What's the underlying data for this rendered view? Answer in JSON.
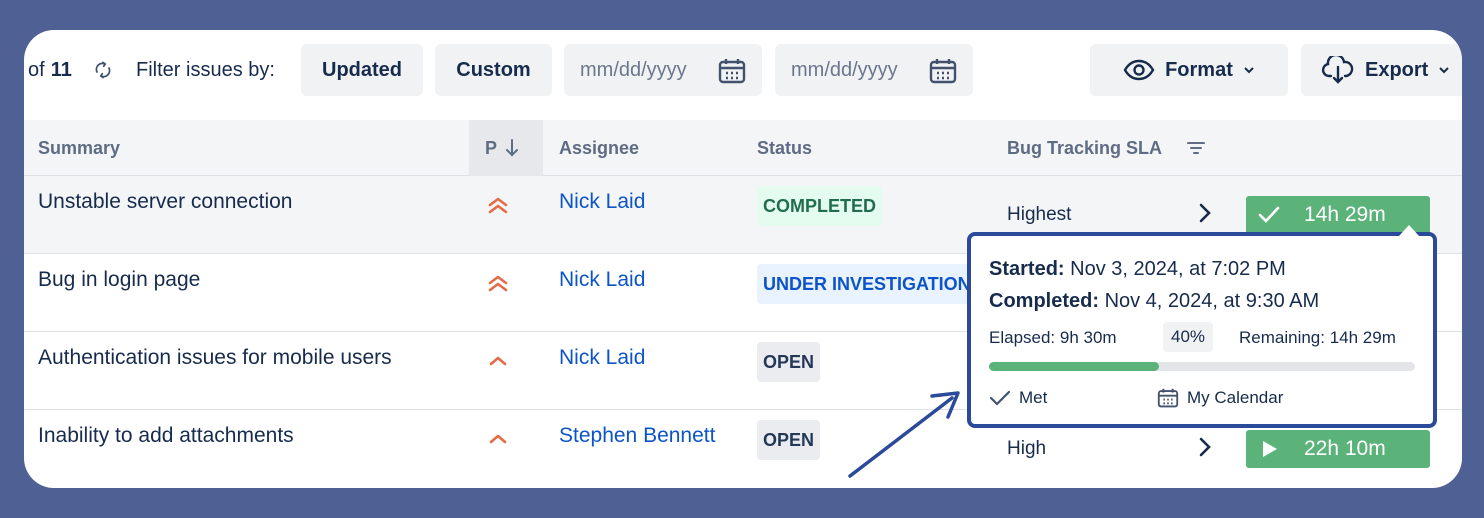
{
  "toolbar": {
    "of_prefix": "of",
    "of_total": "11",
    "filter_label": "Filter issues by:",
    "updated_label": "Updated",
    "custom_label": "Custom",
    "date_placeholder_1": "mm/dd/yyyy",
    "date_placeholder_2": "mm/dd/yyyy",
    "format_label": "Format",
    "export_label": "Export"
  },
  "table": {
    "headers": {
      "summary": "Summary",
      "priority": "P",
      "assignee": "Assignee",
      "status": "Status",
      "sla": "Bug Tracking SLA"
    },
    "rows": [
      {
        "summary": "Unstable server connection",
        "priority_icon": "double-chevron-up-icon",
        "assignee": "Nick Laid",
        "status": "COMPLETED",
        "level": "Highest",
        "sla_time": "14h 29m",
        "sla_icon": "check-icon"
      },
      {
        "summary": "Bug in login page",
        "priority_icon": "double-chevron-up-icon",
        "assignee": "Nick Laid",
        "status": "UNDER INVESTIGATION"
      },
      {
        "summary": "Authentication issues for mobile users",
        "priority_icon": "chevron-up-icon",
        "assignee": "Nick Laid",
        "status": "OPEN"
      },
      {
        "summary": "Inability to add attachments",
        "priority_icon": "chevron-up-icon",
        "assignee": "Stephen Bennett",
        "status": "OPEN",
        "level": "High",
        "sla_time": "22h 10m",
        "sla_icon": "play-icon"
      }
    ]
  },
  "tooltip": {
    "started_label": "Started:",
    "started_value": "Nov 3, 2024, at 7:02 PM",
    "completed_label": "Completed:",
    "completed_value": "Nov 4, 2024, at 9:30 AM",
    "elapsed": "Elapsed: 9h 30m",
    "percent": "40%",
    "progress_fraction": 0.4,
    "remaining": "Remaining: 14h 29m",
    "met": "Met",
    "calendar": "My Calendar"
  },
  "colors": {
    "background": "#4f6194",
    "accent_green": "#5bb37a",
    "link_blue": "#0c54c7",
    "priority_orange": "#e56b47",
    "tooltip_border": "#2b4a9a"
  }
}
